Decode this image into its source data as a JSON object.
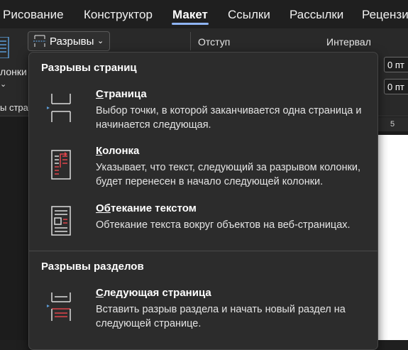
{
  "ribbon_tabs": [
    {
      "label": "Рисование",
      "active": false
    },
    {
      "label": "Конструктор",
      "active": false
    },
    {
      "label": "Макет",
      "active": true
    },
    {
      "label": "Ссылки",
      "active": false
    },
    {
      "label": "Рассылки",
      "active": false
    },
    {
      "label": "Рецензи",
      "active": false
    }
  ],
  "ribbon": {
    "columns_label": "лонки",
    "pages_label": "ы страни",
    "breaks_button_label": "Разрывы",
    "indent_label": "Отступ",
    "spacing_label": "Интервал",
    "spacing_before_value": "0 пт",
    "spacing_after_value": "0 пт",
    "ruler_number": "5"
  },
  "breaks_menu": {
    "page_breaks_header": "Разрывы страниц",
    "section_breaks_header": "Разрывы разделов",
    "items": [
      {
        "title_accel": "С",
        "title_rest": "траница",
        "description": "Выбор точки, в которой заканчивается одна страница и начинается следующая.",
        "icon": "page-break-icon"
      },
      {
        "title_accel": "К",
        "title_rest": "олонка",
        "description": "Указывает, что текст, следующий за разрывом колонки, будет перенесен в начало следующей колонки.",
        "icon": "column-break-icon"
      },
      {
        "title_accel": "Об",
        "title_rest": "текание текстом",
        "description": "Обтекание текста вокруг объектов на веб-страницах.",
        "icon": "text-wrapping-break-icon"
      },
      {
        "title_accel": "С",
        "title_rest": "ледующая страница",
        "description": "Вставить разрыв раздела и начать новый раздел на следующей странице.",
        "icon": "next-page-section-break-icon"
      }
    ]
  },
  "colors": {
    "accent_blue": "#5b9bd5",
    "accent_red": "#e0454b",
    "tab_underline": "#8fb4f5"
  }
}
